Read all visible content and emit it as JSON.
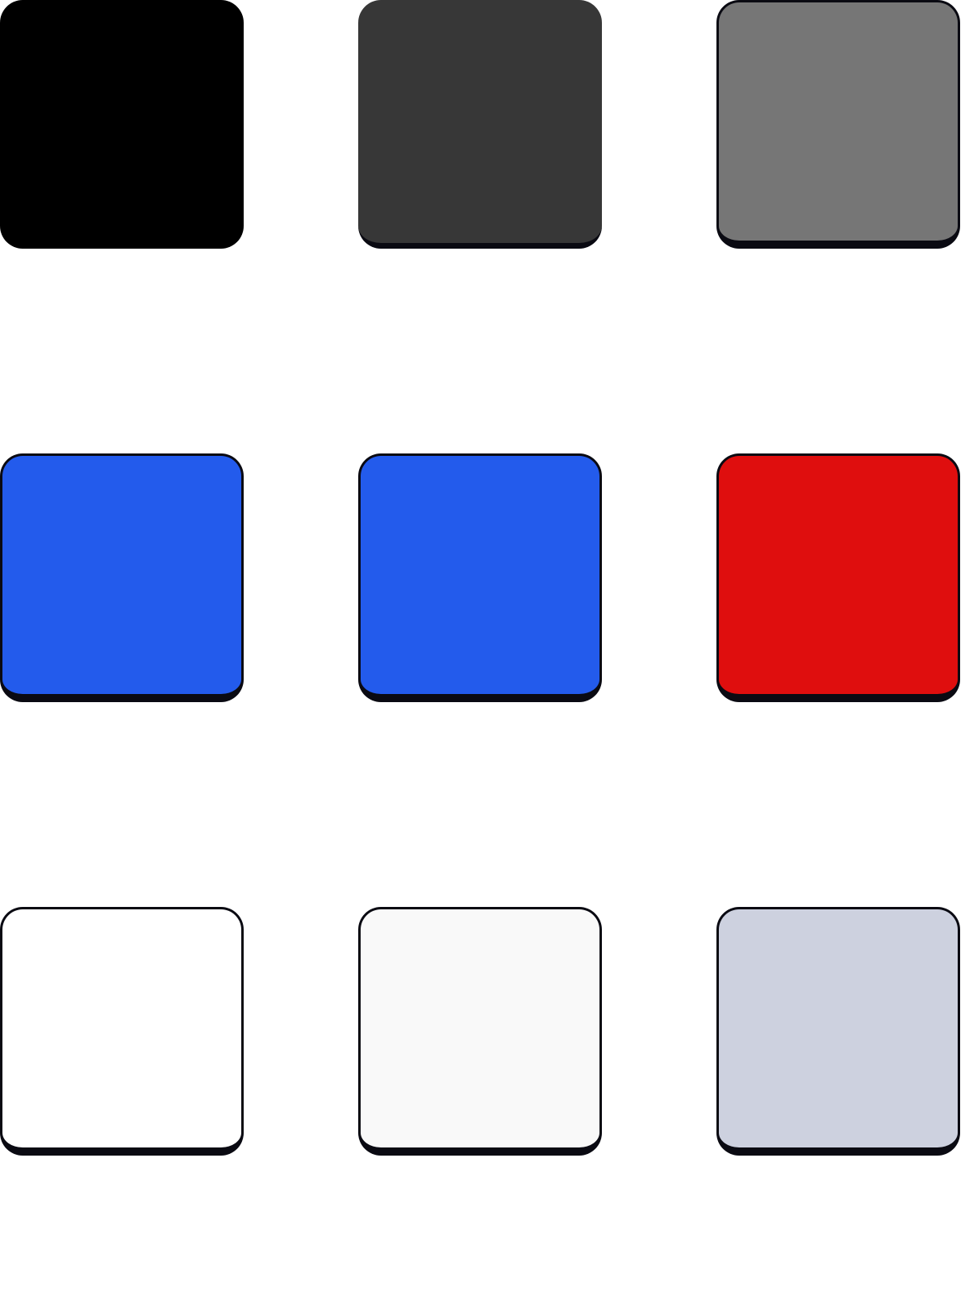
{
  "swatches": [
    {
      "name": "swatch-black",
      "color": "#000000"
    },
    {
      "name": "swatch-dark-gray",
      "color": "#373737"
    },
    {
      "name": "swatch-gray",
      "color": "#767676"
    },
    {
      "name": "swatch-blue",
      "color": "#235BEC"
    },
    {
      "name": "swatch-blue-2",
      "color": "#235BEC"
    },
    {
      "name": "swatch-red",
      "color": "#DF0E0E"
    },
    {
      "name": "swatch-white",
      "color": "#FFFFFF"
    },
    {
      "name": "swatch-off-white",
      "color": "#F9F9F9"
    },
    {
      "name": "swatch-light-slate",
      "color": "#CDD1DF"
    }
  ]
}
